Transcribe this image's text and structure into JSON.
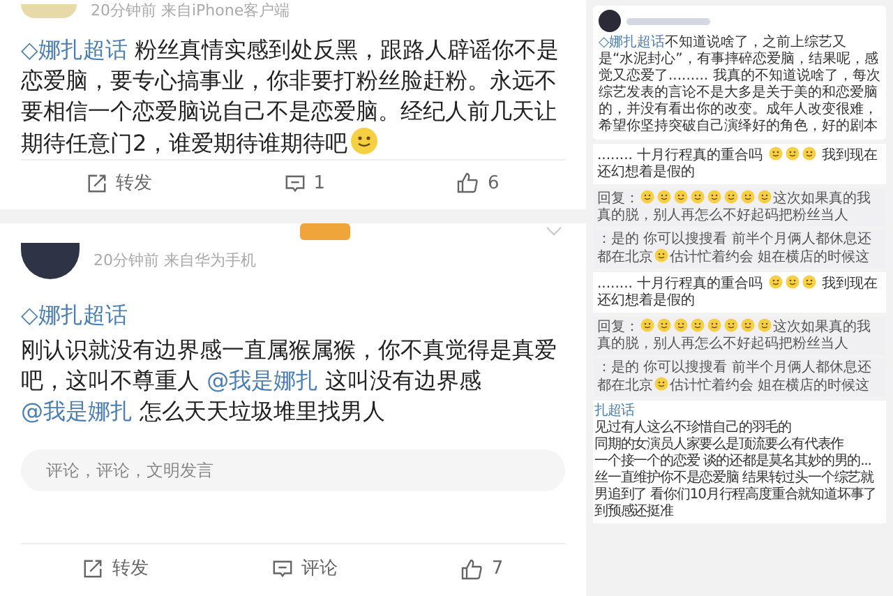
{
  "posts": [
    {
      "meta": "20分钟前  来自iPhone客户端",
      "topic": "◇娜扎超话",
      "segments": [
        {
          "kind": "text",
          "text": " 粉丝真情实感到处反黑，跟路人辟谣你不是恋爱脑，要专心搞事业，你非要打粉丝脸赶粉。永远不要相信一个恋爱脑说自己不是恋爱脑。经纪人前几天让期待任意门2，谁爱期待谁期待吧"
        },
        {
          "kind": "emoji"
        }
      ],
      "topic_inline": true,
      "actions": [
        "转发",
        "1",
        "6"
      ]
    },
    {
      "meta": "20分钟前  来自华为手机",
      "topic": "◇娜扎超话",
      "segments": [
        {
          "kind": "text",
          "text": "刚认识就没有边界感一直属猴属猴，你不真觉得是真爱吧，这叫不尊重人 "
        },
        {
          "kind": "mention",
          "text": "@我是娜扎"
        },
        {
          "kind": "text",
          "text": " 这叫没有边界感 "
        },
        {
          "kind": "mention",
          "text": "@我是娜扎"
        },
        {
          "kind": "text",
          "text": " 怎么天天垃圾堆里找男人"
        }
      ],
      "topic_inline": false,
      "comment_placeholder": "评论，评论，文明发言",
      "actions": [
        "转发",
        "评论",
        "7"
      ]
    }
  ],
  "side": [
    {
      "kind": "post",
      "topic": "◇娜扎超话",
      "segments": [
        {
          "kind": "text",
          "text": "不知道说啥了，之前上综艺又是“水泥封心”，有事摔碎恋爱脑，结果呢，感觉又恋爱了......... 我真的不知道说啥了，每次综艺发表的言论不是大多是关于美的和恋爱脑的，并没有看出你的改变。成年人改变很难，希望你坚持突破自己演绎好的角色，好的剧本"
        }
      ]
    },
    {
      "kind": "line",
      "segments": [
        {
          "kind": "text",
          "text": "........ 十月行程真的重合吗 "
        },
        {
          "kind": "emoji"
        },
        {
          "kind": "emoji"
        },
        {
          "kind": "emoji"
        },
        {
          "kind": "text",
          "text": " 我到现在还幻想着是假的"
        }
      ]
    },
    {
      "kind": "reply",
      "segments": [
        {
          "kind": "text",
          "text": "回复："
        },
        {
          "kind": "emoji"
        },
        {
          "kind": "emoji"
        },
        {
          "kind": "emoji"
        },
        {
          "kind": "emoji"
        },
        {
          "kind": "emoji"
        },
        {
          "kind": "emoji"
        },
        {
          "kind": "emoji"
        },
        {
          "kind": "emoji"
        },
        {
          "kind": "text",
          "text": "这次如果真的我真的脱，别人再怎么不好起码把粉丝当人"
        }
      ]
    },
    {
      "kind": "reply",
      "segments": [
        {
          "kind": "text",
          "text": "：是的 你可以搜搜看 前半个月俩人都休息还都在北京"
        },
        {
          "kind": "emoji"
        },
        {
          "kind": "text",
          "text": "估计忙着约会 姐在横店的时候这"
        }
      ]
    },
    {
      "kind": "line",
      "segments": [
        {
          "kind": "text",
          "text": "........ 十月行程真的重合吗 "
        },
        {
          "kind": "emoji"
        },
        {
          "kind": "emoji"
        },
        {
          "kind": "emoji"
        },
        {
          "kind": "text",
          "text": " 我到现在还幻想着是假的"
        }
      ]
    },
    {
      "kind": "reply",
      "segments": [
        {
          "kind": "text",
          "text": "回复："
        },
        {
          "kind": "emoji"
        },
        {
          "kind": "emoji"
        },
        {
          "kind": "emoji"
        },
        {
          "kind": "emoji"
        },
        {
          "kind": "emoji"
        },
        {
          "kind": "emoji"
        },
        {
          "kind": "emoji"
        },
        {
          "kind": "emoji"
        },
        {
          "kind": "text",
          "text": "这次如果真的我真的脱，别人再怎么不好起码把粉丝当人"
        }
      ]
    },
    {
      "kind": "reply",
      "segments": [
        {
          "kind": "text",
          "text": "：是的 你可以搜搜看 前半个月俩人都休息还都在北京"
        },
        {
          "kind": "emoji"
        },
        {
          "kind": "text",
          "text": "估计忙着约会 姐在横店的时候这"
        }
      ]
    },
    {
      "kind": "lines",
      "topic": "扎超话",
      "lines": [
        "见过有人这么不珍惜自己的羽毛的",
        "同期的女演员人家要么是顶流要么有代表作",
        "一个接一个的恋爱 谈的还都是莫名其妙的男的...",
        "丝一直维护你不是恋爱脑 结果转过头一个综艺就",
        "男追到了 看你们10月行程高度重合就知道坏事了",
        "到预感还挺准"
      ]
    }
  ]
}
